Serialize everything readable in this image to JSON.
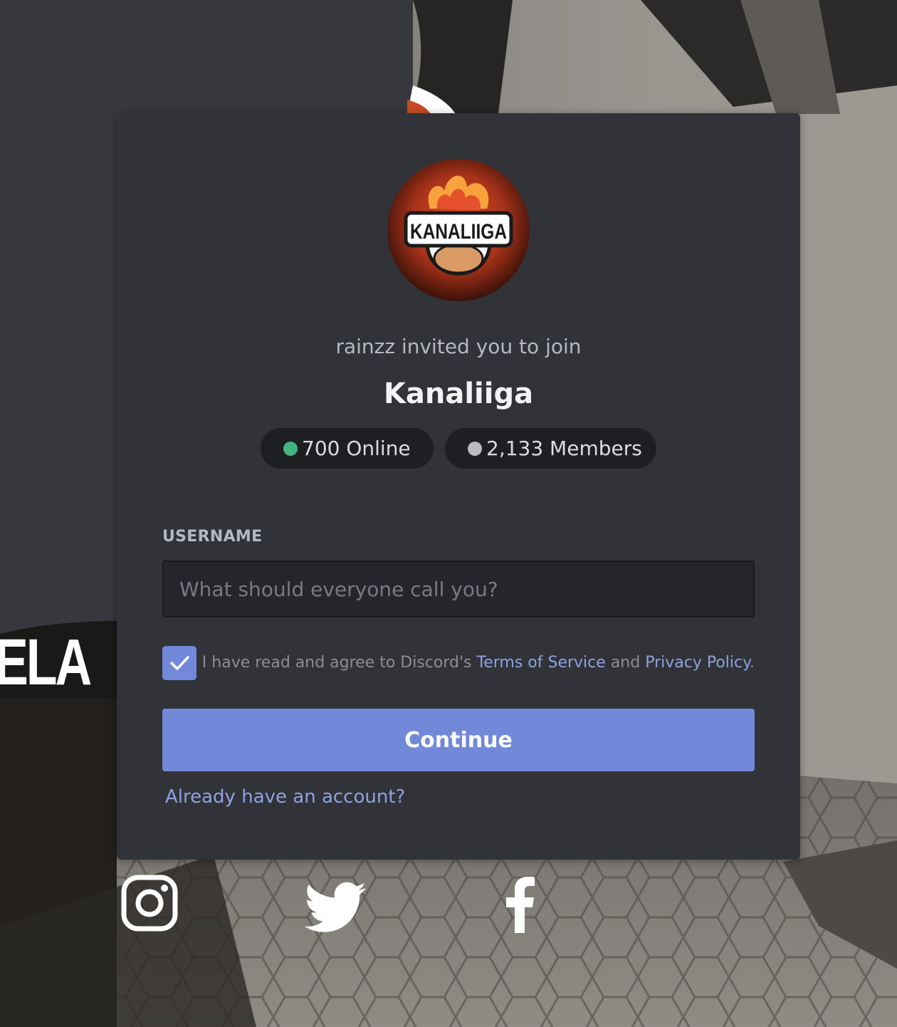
{
  "invite": {
    "inviter_text": "rainzz invited you to join",
    "server_name": "Kanaliiga",
    "logo_text": "KANALIIGA",
    "online_label": "700 Online",
    "members_label": "2,133 Members"
  },
  "form": {
    "username_label": "USERNAME",
    "username_placeholder": "What should everyone call you?",
    "username_value": "",
    "terms_checked": true,
    "agree_prefix": "I have read and agree to Discord's",
    "terms_link": "Terms of Service",
    "agree_and": "and",
    "privacy_link": "Privacy Policy",
    "agree_suffix": ".",
    "continue_label": "Continue",
    "login_link": "Already have an account?"
  },
  "background": {
    "partial_logo_text": "ELA"
  },
  "social_icons": [
    "instagram-icon",
    "twitter-icon",
    "facebook-icon"
  ],
  "colors": {
    "accent": "#7289da",
    "link": "#8ea1e1",
    "online_dot": "#43b581",
    "members_dot": "#b9bbbe",
    "card_bg": "#313338"
  }
}
